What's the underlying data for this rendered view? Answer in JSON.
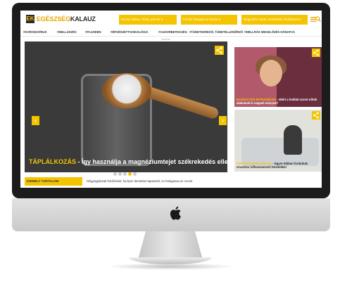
{
  "site": {
    "logo_mark": "EK",
    "logo_text_a": "EGÉSZSÉG",
    "logo_text_b": "KALAUZ"
  },
  "header": {
    "dropdowns": [
      "Mi van ebben: hírek, percek ▾",
      "Pozitív hangulat & közön ▾",
      "Diagnózis: tünet, kezelések, fertőzések ▾"
    ]
  },
  "nav": {
    "items": [
      "#KORONAVÍRUS",
      "#MELLÚSZÉS",
      "#FAJZIDEN",
      "#ÉRVÉSZETTOXIKOLÓGIA",
      "#CUKORBETEGSÉG",
      "#TÜNETKERESŐ, TÜNETELLENŐRZŐ",
      "#MELLRÁK MEGELŐZÉS HÓNAPJA"
    ]
  },
  "ad_label": "Hirdetés",
  "main_slide": {
    "category": "TÁPLÁLKOZÁS",
    "title": " - Így használja a magnéziumtejet székrekedés ellen!"
  },
  "side_cards": [
    {
      "category": "BAGNÁLTOS BETEGSÉGEK",
      "title": " - Miért a holdak szoret nőtok alakulnak ki nappali arányok?"
    },
    {
      "category": "FERTŐZŐ BETEGSÉGEK",
      "title": " - Egyre többen fordulnak orvoshoz influenzaszerű tünetekkel"
    }
  ],
  "featured": {
    "label": "KIEMELT TARTALOM",
    "text": "Nőgyógyászati fertőzések: ha ilyen tüneteket tapasztal, ne halogassa az orvost"
  },
  "colors": {
    "accent": "#f5c400",
    "dark": "#2b2b2b"
  }
}
